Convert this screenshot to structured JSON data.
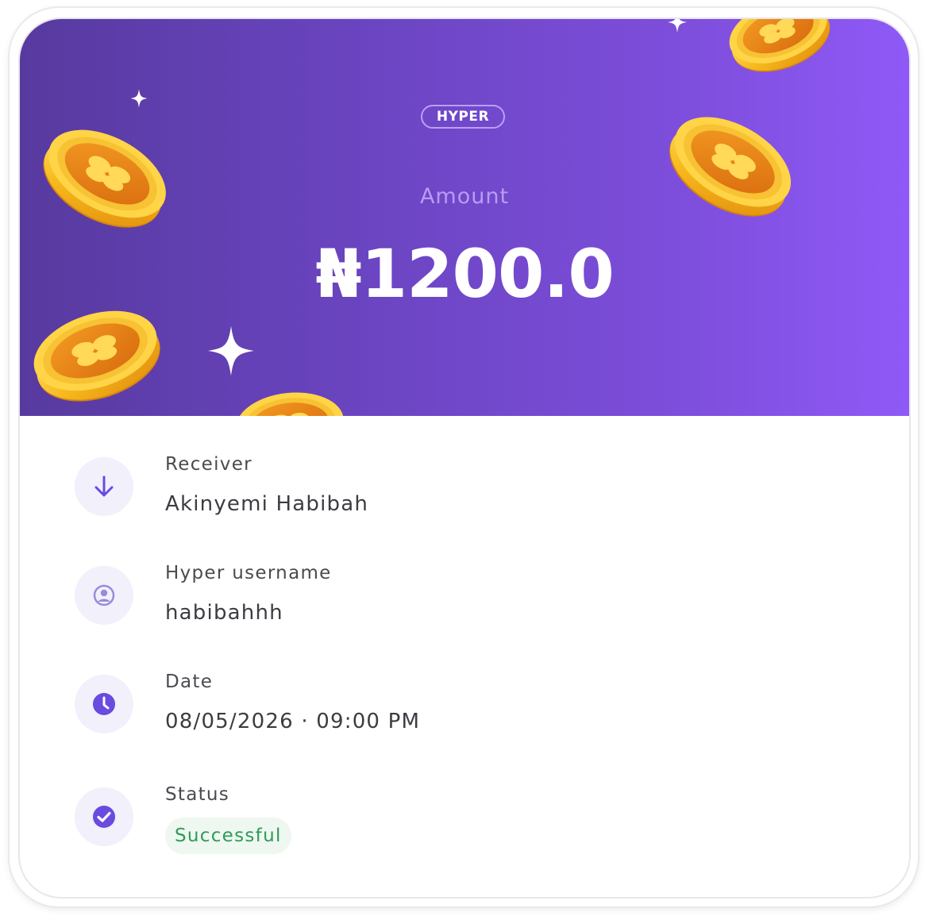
{
  "receipt": {
    "brand": "HYPER",
    "amount_label": "Amount",
    "amount_value": "₦1200.0",
    "colors": {
      "hero_gradient_start": "#573a9f",
      "hero_gradient_end": "#8f59f7",
      "icon_accent": "#6a4be0",
      "success_text": "#2f9a59",
      "success_bg": "#eef7f0"
    },
    "details": [
      {
        "icon": "arrow-down-icon",
        "label": "Receiver",
        "value": "Akinyemi Habibah"
      },
      {
        "icon": "user-circle-icon",
        "label": "Hyper username",
        "value": "habibahhh"
      },
      {
        "icon": "clock-icon",
        "label": "Date",
        "value": "08/05/2026 · 09:00 PM"
      },
      {
        "icon": "check-circle-icon",
        "label": "Status",
        "value": "Successful"
      }
    ]
  }
}
